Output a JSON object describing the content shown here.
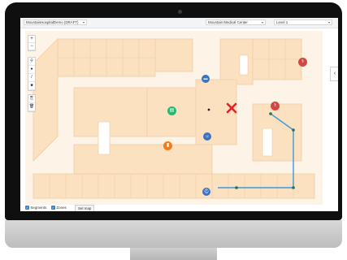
{
  "header": {
    "floorplan_select": "MountainHospitalDemo (DRAFT)",
    "facility_select": "Mountain Medical Center",
    "level_select": "Level 1",
    "caret": "▾"
  },
  "map_controls": {
    "zoom_in": "+",
    "zoom_out": "−",
    "tools": [
      "⚲",
      "●",
      "/",
      "■"
    ],
    "tools2": [
      "⎘",
      "🗑"
    ]
  },
  "side_panel_toggle": "‹",
  "footer": {
    "segments_label": "Segments",
    "zones_label": "Zones",
    "set_map_label": "Set map",
    "check": "✓"
  },
  "colors": {
    "floorplan_fill": "#fbe2c0",
    "floorplan_line": "#e9c99f",
    "route_line": "#3a9ad9",
    "route_node": "#2c6b4f",
    "error_marker": "#e8202a"
  },
  "markers": [
    {
      "name": "marker-red-staff-icon",
      "color": "#d64545",
      "glyph": "⚕"
    },
    {
      "name": "marker-blue-bed-icon",
      "color": "#3b73c4",
      "glyph": "▬"
    },
    {
      "name": "marker-red-staff-icon-2",
      "color": "#d64545",
      "glyph": "⚕"
    },
    {
      "name": "marker-green-device-icon",
      "color": "#2bb673",
      "glyph": "▤"
    },
    {
      "name": "marker-blue-person-icon",
      "color": "#3b73c4",
      "glyph": "☺"
    },
    {
      "name": "marker-orange-equipment-icon",
      "color": "#f07d1f",
      "glyph": "▮"
    },
    {
      "name": "marker-blue-route-icon",
      "color": "#3b73c4",
      "glyph": "⛑"
    }
  ],
  "error_marker_glyph": "✕"
}
